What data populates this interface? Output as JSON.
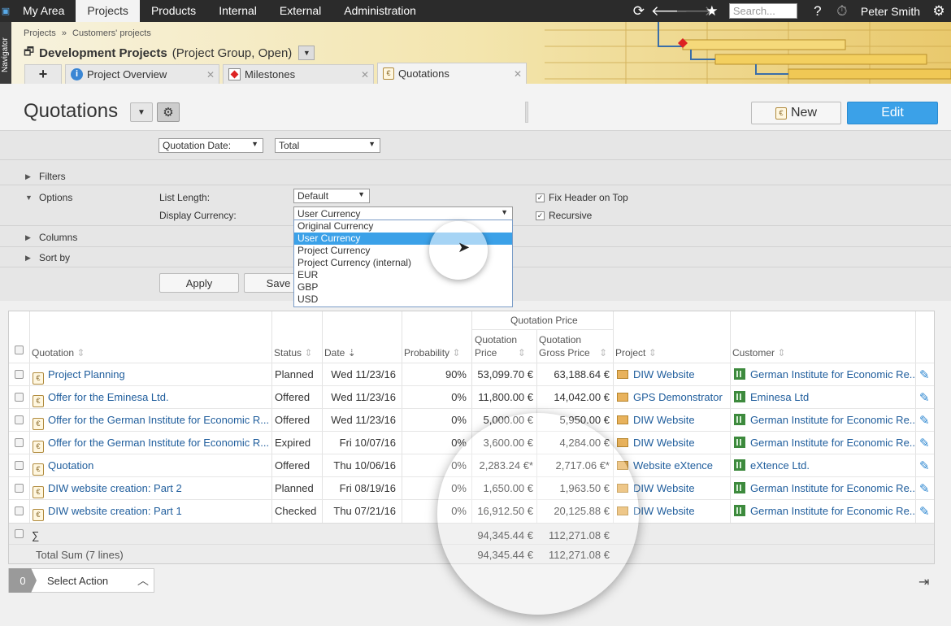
{
  "topnav": {
    "items": [
      "My Area",
      "Projects",
      "Products",
      "Internal",
      "External",
      "Administration"
    ],
    "active": "Projects",
    "search_placeholder": "Search...",
    "help": "?",
    "user": "Peter Smith"
  },
  "navigator_label": "Navigator",
  "breadcrumb": {
    "items": [
      "Projects",
      "Customers' projects"
    ],
    "sep": "»"
  },
  "project": {
    "name": "Development Projects",
    "meta": "(Project Group, Open)"
  },
  "tabs": [
    {
      "label": "Project Overview"
    },
    {
      "label": "Milestones"
    },
    {
      "label": "Quotations"
    }
  ],
  "page": {
    "title": "Quotations",
    "new_label": "New",
    "edit_label": "Edit"
  },
  "groupings": {
    "first": "Quotation Date:",
    "second": "Total"
  },
  "sections": {
    "filters": "Filters",
    "options": "Options",
    "columns": "Columns",
    "sort_by": "Sort by"
  },
  "options": {
    "list_length_label": "List Length:",
    "list_length_value": "Default",
    "display_currency_label": "Display Currency:",
    "display_currency_value": "User Currency",
    "fix_header_label": "Fix Header on Top",
    "recursive_label": "Recursive",
    "currency_options": [
      "Original Currency",
      "User Currency",
      "Project Currency",
      "Project Currency (internal)",
      "EUR",
      "GBP",
      "USD"
    ]
  },
  "buttons": {
    "apply": "Apply",
    "save": "Save"
  },
  "table": {
    "group_header": "Quotation Price",
    "headers": {
      "quotation": "Quotation",
      "status": "Status",
      "date": "Date",
      "probability": "Probability",
      "price_l1": "Quotation",
      "price_l2": "Price",
      "gross_l1": "Quotation",
      "gross_l2": "Gross Price",
      "project": "Project",
      "customer": "Customer"
    },
    "rows": [
      {
        "quotation": "Project Planning",
        "status": "Planned",
        "date": "Wed 11/23/16",
        "probability": "90%",
        "price": "53,099.70 €",
        "gross": "63,188.64 €",
        "project": "DIW Website",
        "customer": "German Institute for Economic Re..."
      },
      {
        "quotation": "Offer for the Eminesa Ltd.",
        "status": "Offered",
        "date": "Wed 11/23/16",
        "probability": "0%",
        "price": "11,800.00 €",
        "gross": "14,042.00 €",
        "project": "GPS Demonstrator",
        "customer": "Eminesa Ltd"
      },
      {
        "quotation": "Offer for the German Institute for Economic R...",
        "status": "Offered",
        "date": "Wed 11/23/16",
        "probability": "0%",
        "price": "5,000.00 €",
        "gross": "5,950.00 €",
        "project": "DIW Website",
        "customer": "German Institute for Economic Re..."
      },
      {
        "quotation": "Offer for the German Institute for Economic R...",
        "status": "Expired",
        "date": "Fri 10/07/16",
        "probability": "0%",
        "price": "3,600.00 €",
        "gross": "4,284.00 €",
        "project": "DIW Website",
        "customer": "German Institute for Economic Re..."
      },
      {
        "quotation": "Quotation",
        "status": "Offered",
        "date": "Thu 10/06/16",
        "probability": "0%",
        "price": "2,283.24 €*",
        "gross": "2,717.06 €*",
        "project": "Website eXtence",
        "customer": "eXtence Ltd."
      },
      {
        "quotation": "DIW website creation: Part 2",
        "status": "Planned",
        "date": "Fri 08/19/16",
        "probability": "0%",
        "price": "1,650.00 €",
        "gross": "1,963.50 €",
        "project": "DIW Website",
        "customer": "German Institute for Economic Re..."
      },
      {
        "quotation": "DIW website creation: Part 1",
        "status": "Checked",
        "date": "Thu 07/21/16",
        "probability": "0%",
        "price": "16,912.50 €",
        "gross": "20,125.88 €",
        "project": "DIW Website",
        "customer": "German Institute for Economic Re..."
      }
    ],
    "sum_symbol": "∑",
    "sum_price": "94,345.44 €",
    "sum_gross": "112,271.08 €",
    "total_label": "Total Sum (7 lines)",
    "total_price": "94,345.44 €",
    "total_gross": "112,271.08 €"
  },
  "footer": {
    "selected_count": "0",
    "action_label": "Select Action"
  },
  "colors": {
    "accent": "#3ba1e8",
    "link": "#1f5d9c",
    "topbar": "#2b2b2b"
  }
}
